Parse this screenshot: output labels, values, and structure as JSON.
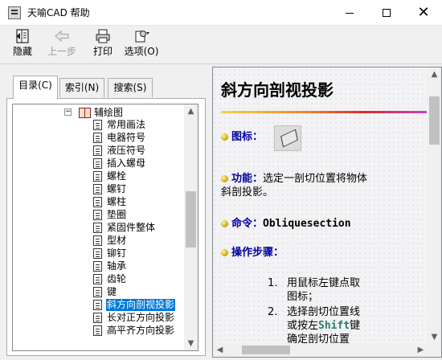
{
  "window": {
    "title": "天喻CAD 帮助",
    "icons": [
      "app-icon",
      "minimize-icon",
      "maximize-icon",
      "close-icon"
    ]
  },
  "toolbar": {
    "hide": "隐藏",
    "back": "上一步",
    "print": "打印",
    "options": "选项(O)",
    "back_disabled": true
  },
  "tabs": [
    {
      "label": "目录(C)",
      "active": true
    },
    {
      "label": "索引(N)",
      "active": false
    },
    {
      "label": "搜索(S)",
      "active": false
    }
  ],
  "tree": {
    "parent": "辅绘图",
    "items": [
      "常用画法",
      "电器符号",
      "液压符号",
      "插入螺母",
      "螺栓",
      "螺钉",
      "螺柱",
      "垫圈",
      "紧固件整体",
      "型材",
      "铆钉",
      "轴承",
      "齿轮",
      "键",
      "斜方向剖视投影",
      "长对正方向投影",
      "高平齐方向投影"
    ],
    "selected": "斜方向剖视投影"
  },
  "content": {
    "title": "斜方向剖视投影",
    "icon_label": "图标：",
    "function_label": "功能：",
    "function_text": "选定一剖切位置将物体斜剖投影。",
    "function_line1": "选定一剖切位置将物体",
    "function_line2": "斜剖投影。",
    "command_label": "命令：",
    "command_value": "Obliquesection",
    "steps_label": "操作步骤：",
    "steps": [
      {
        "num": "1.",
        "line1": "用鼠标左键点取",
        "line2": "图标；"
      },
      {
        "num": "2.",
        "line1": "选择剖切位置线",
        "line2_prefix": "或按左",
        "keyword": "Shift",
        "line2_suffix": "键",
        "line3": "确定剖切位置"
      }
    ],
    "accent_colors": [
      "#f3d24a",
      "#f08a2a",
      "#d42a2a",
      "#d040c0"
    ]
  }
}
